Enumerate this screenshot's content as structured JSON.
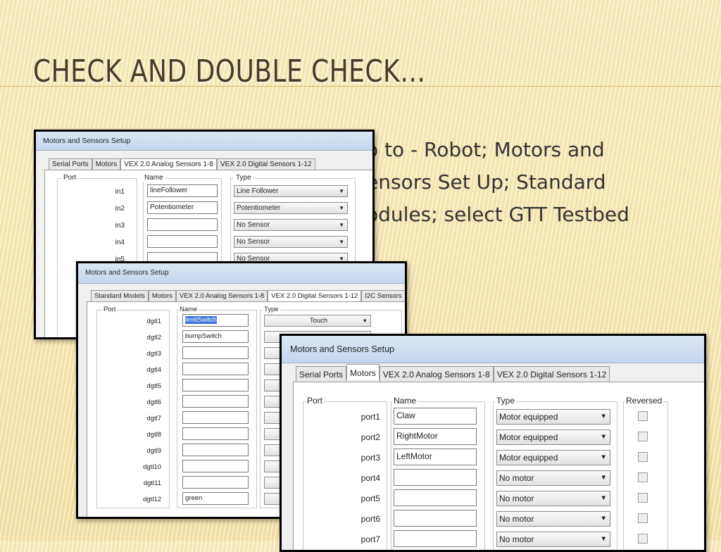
{
  "slide": {
    "title": "CHECK AND DOUBLE CHECK…",
    "bullet_lines": [
      "o to - Robot; Motors and",
      "ensors Set Up; Standard",
      "odules; select GTT Testbed"
    ]
  },
  "dialog_analog": {
    "title": "Motors and Sensors Setup",
    "tabs": [
      "Serial Ports",
      "Motors",
      "VEX 2.0 Analog Sensors 1-8",
      "VEX 2.0 Digital Sensors 1-12"
    ],
    "headers": {
      "port": "Port",
      "name": "Name",
      "type": "Type"
    },
    "rows": [
      {
        "port": "in1",
        "name": "lineFollower",
        "type": "Line Follower"
      },
      {
        "port": "in2",
        "name": "Potentiometer",
        "type": "Potentiometer"
      },
      {
        "port": "in3",
        "name": "",
        "type": "No Sensor"
      },
      {
        "port": "in4",
        "name": "",
        "type": "No Sensor"
      },
      {
        "port": "in5",
        "name": "",
        "type": "No Sensor"
      }
    ]
  },
  "dialog_digital": {
    "title": "Motors and Sensors Setup",
    "tabs": [
      "Standard Models",
      "Motors",
      "VEX 2.0 Analog Sensors 1-8",
      "VEX 2.0 Digital Sensors 1-12",
      "I2C Sensors"
    ],
    "headers": {
      "port": "Port",
      "name": "Name",
      "type": "Type"
    },
    "rows": [
      {
        "port": "dgtl1",
        "name": "limitSwitch",
        "type": "Touch"
      },
      {
        "port": "dgtl2",
        "name": "bumpSwitch",
        "type": ""
      },
      {
        "port": "dgtl3",
        "name": "",
        "type": ""
      },
      {
        "port": "dgtl4",
        "name": "",
        "type": ""
      },
      {
        "port": "dgtl5",
        "name": "",
        "type": ""
      },
      {
        "port": "dgtl6",
        "name": "",
        "type": ""
      },
      {
        "port": "dgtl7",
        "name": "",
        "type": ""
      },
      {
        "port": "dgtl8",
        "name": "",
        "type": ""
      },
      {
        "port": "dgtl9",
        "name": "",
        "type": ""
      },
      {
        "port": "dgtl10",
        "name": "",
        "type": ""
      },
      {
        "port": "dgtl11",
        "name": "",
        "type": ""
      },
      {
        "port": "dgtl12",
        "name": "green",
        "type": ""
      }
    ]
  },
  "dialog_motors": {
    "title": "Motors and Sensors Setup",
    "tabs": [
      "Serial Ports",
      "Motors",
      "VEX 2.0 Analog Sensors 1-8",
      "VEX 2.0 Digital Sensors 1-12"
    ],
    "headers": {
      "port": "Port",
      "name": "Name",
      "type": "Type",
      "reversed": "Reversed"
    },
    "rows": [
      {
        "port": "port1",
        "name": "Claw",
        "type": "Motor equipped"
      },
      {
        "port": "port2",
        "name": "RightMotor",
        "type": "Motor equipped"
      },
      {
        "port": "port3",
        "name": "LeftMotor",
        "type": "Motor equipped"
      },
      {
        "port": "port4",
        "name": "",
        "type": "No motor"
      },
      {
        "port": "port5",
        "name": "",
        "type": "No motor"
      },
      {
        "port": "port6",
        "name": "",
        "type": "No motor"
      },
      {
        "port": "port7",
        "name": "",
        "type": "No motor"
      }
    ]
  }
}
